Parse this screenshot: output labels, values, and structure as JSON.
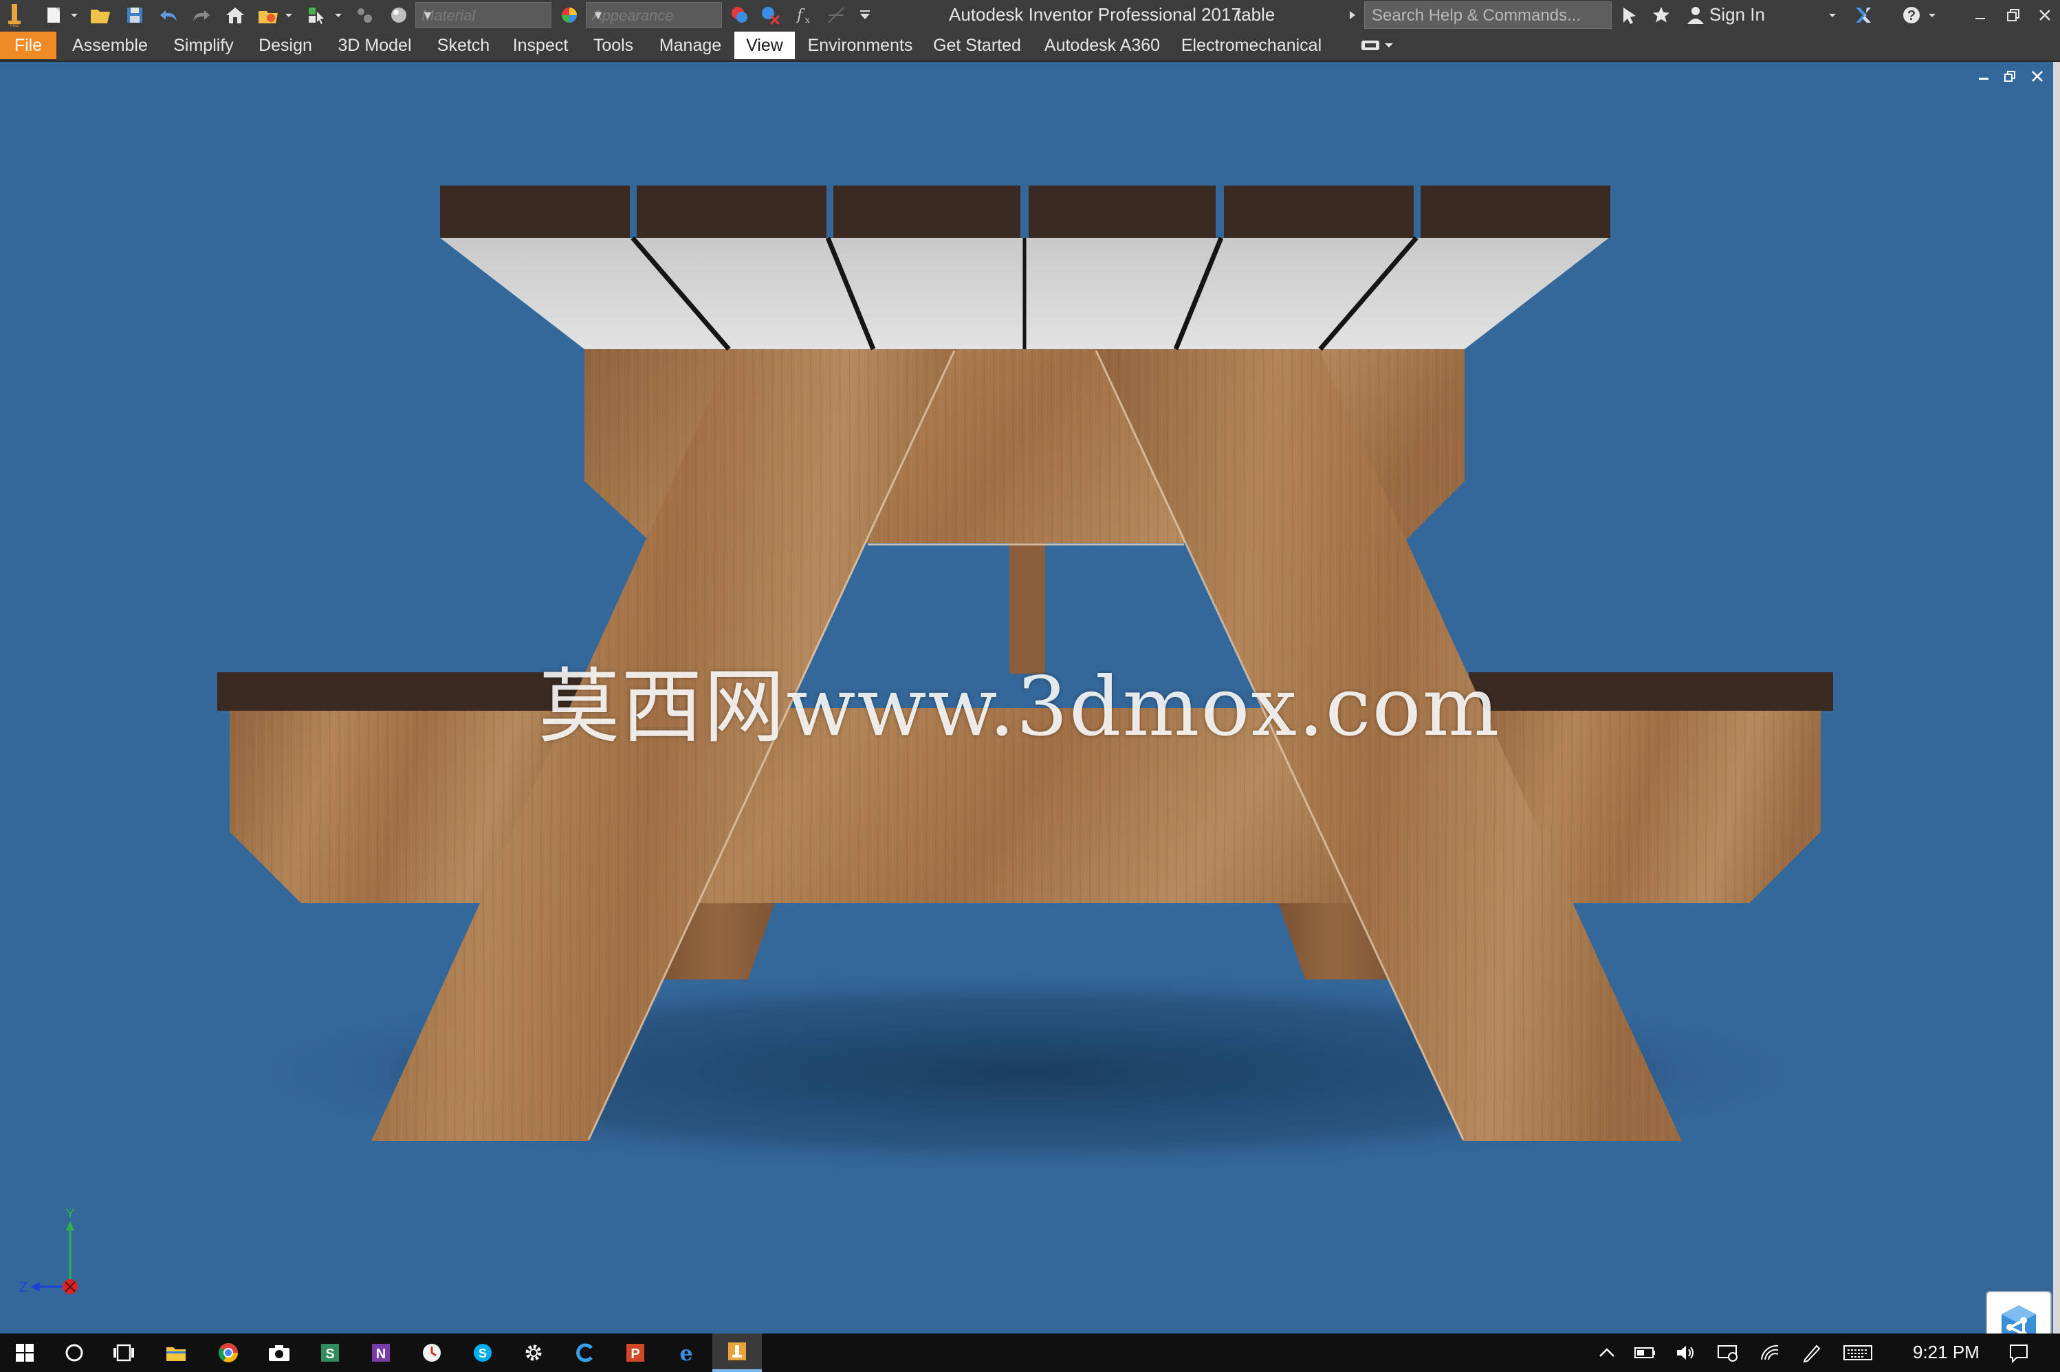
{
  "titlebar": {
    "app_title": "Autodesk Inventor Professional 2017",
    "document": "table",
    "material_placeholder": "Material",
    "appearance_placeholder": "Appearance",
    "search_placeholder": "Search Help & Commands...",
    "sign_in": "Sign In"
  },
  "ribbon": {
    "tabs": [
      "File",
      "Assemble",
      "Simplify",
      "Design",
      "3D Model",
      "Sketch",
      "Inspect",
      "Tools",
      "Manage",
      "View",
      "Environments",
      "Get Started",
      "Autodesk A360",
      "Electromechanical"
    ],
    "active": "View"
  },
  "viewport": {
    "watermark": "莫西网www.3dmox.com",
    "background": "#34679a",
    "triad": {
      "y": "Y",
      "z": "Z"
    }
  },
  "taskbar": {
    "time": "9:21 PM"
  },
  "colors": {
    "accent_file": "#f08a24",
    "ribbon_bg": "#3c3c3c",
    "wood": "#a8774e",
    "plank_top": "#3a2a22",
    "plank_face": "#d4d4d4"
  }
}
